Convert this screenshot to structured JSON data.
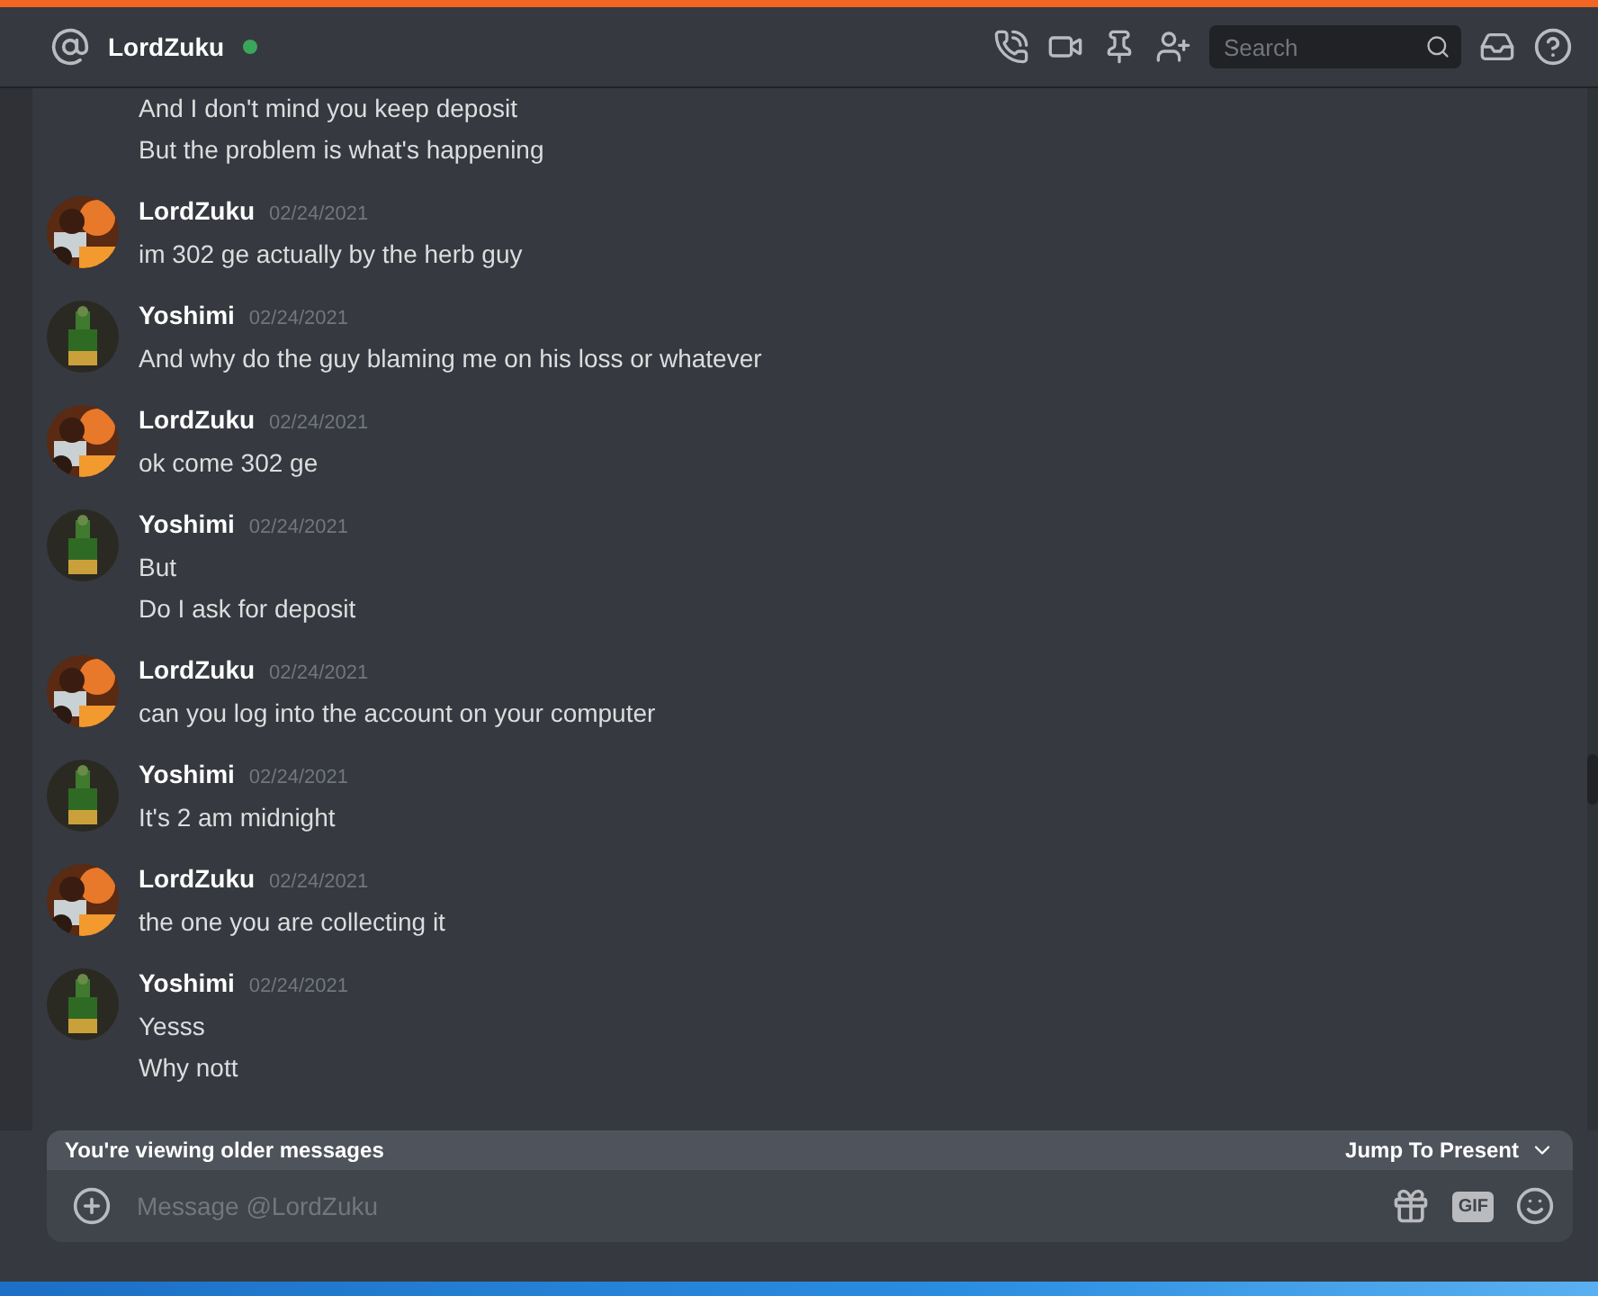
{
  "header": {
    "name": "LordZuku",
    "online": true,
    "search": {
      "placeholder": "Search"
    }
  },
  "continuation": [
    "And I don't mind you keep deposit",
    "But the problem is what's happening"
  ],
  "messages": [
    {
      "author": "LordZuku",
      "time": "02/24/2021",
      "lines": [
        "im 302 ge actually by the herb guy"
      ]
    },
    {
      "author": "Yoshimi",
      "time": "02/24/2021",
      "lines": [
        "And why do the guy blaming me on his loss or whatever"
      ]
    },
    {
      "author": "LordZuku",
      "time": "02/24/2021",
      "lines": [
        "ok come 302 ge"
      ]
    },
    {
      "author": "Yoshimi",
      "time": "02/24/2021",
      "lines": [
        "But",
        "Do I ask for deposit"
      ]
    },
    {
      "author": "LordZuku",
      "time": "02/24/2021",
      "lines": [
        "can you log into the account on your computer"
      ]
    },
    {
      "author": "Yoshimi",
      "time": "02/24/2021",
      "lines": [
        "It's 2 am midnight"
      ]
    },
    {
      "author": "LordZuku",
      "time": "02/24/2021",
      "lines": [
        "the one you are collecting it"
      ]
    },
    {
      "author": "Yoshimi",
      "time": "02/24/2021",
      "lines": [
        "Yesss",
        "Why nott"
      ]
    }
  ],
  "older_bar": {
    "text": "You're viewing older messages",
    "jump": "Jump To Present"
  },
  "composer": {
    "placeholder": "Message @LordZuku",
    "gif_label": "GIF"
  }
}
